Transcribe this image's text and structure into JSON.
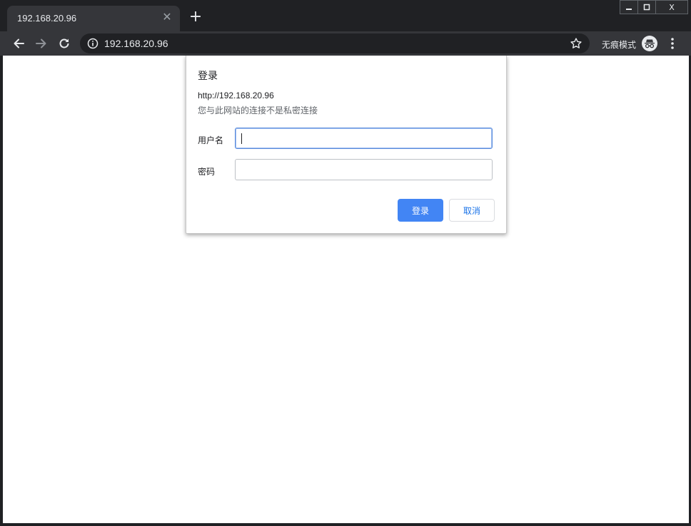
{
  "tab": {
    "title": "192.168.20.96",
    "close_glyph": "✕"
  },
  "new_tab_glyph": "+",
  "window_controls": {
    "minimize": "—",
    "maximize": "▢",
    "close": "X"
  },
  "toolbar": {
    "url": "192.168.20.96",
    "incognito_label": "无痕模式"
  },
  "dialog": {
    "title": "登录",
    "origin": "http://192.168.20.96",
    "warning": "您与此网站的连接不是私密连接",
    "username_label": "用户名",
    "username_value": "",
    "password_label": "密码",
    "password_value": "",
    "login_button": "登录",
    "cancel_button": "取消"
  },
  "colors": {
    "accent": "#4285f4",
    "frame": "#202124",
    "toolbar": "#35363a"
  },
  "icons": [
    "back-arrow-icon",
    "forward-arrow-icon",
    "reload-icon",
    "info-icon",
    "star-icon",
    "incognito-icon",
    "more-vert-icon"
  ]
}
